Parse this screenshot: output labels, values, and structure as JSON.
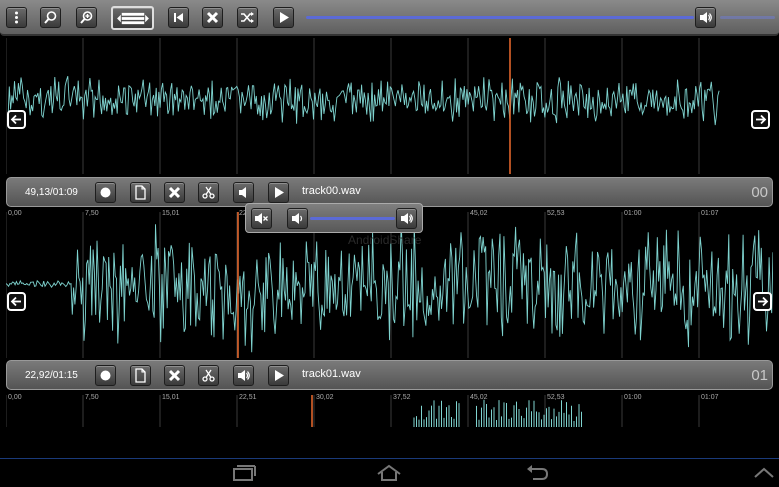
{
  "toolbar": {
    "buttons": [
      "menu-icon",
      "zoom-out-icon",
      "zoom-in-icon",
      "fit-width-icon",
      "skip-back-icon",
      "close-icon",
      "shuffle-icon",
      "play-icon"
    ],
    "volume_icon": "speaker-icon",
    "progress": 0.93
  },
  "tracks": [
    {
      "time": "49,13/01:09",
      "name": "track00.wav",
      "number": "00",
      "volume_icon": "speaker-low-icon"
    },
    {
      "time": "22,92/01:15",
      "name": "track01.wav",
      "number": "01",
      "volume_icon": "speaker-icon"
    }
  ],
  "ruler": [
    "0,00",
    "7,50",
    "15,01",
    "22,51",
    "30,02",
    "37,52",
    "45,02",
    "52,53",
    "01:00",
    "01:07"
  ],
  "volume_popup": {
    "level": 0.75
  },
  "colors": {
    "wave": "#7fd4d0",
    "cursor": "#e0642a",
    "accent": "#5b6ad6"
  },
  "watermark": "AndroidShare"
}
